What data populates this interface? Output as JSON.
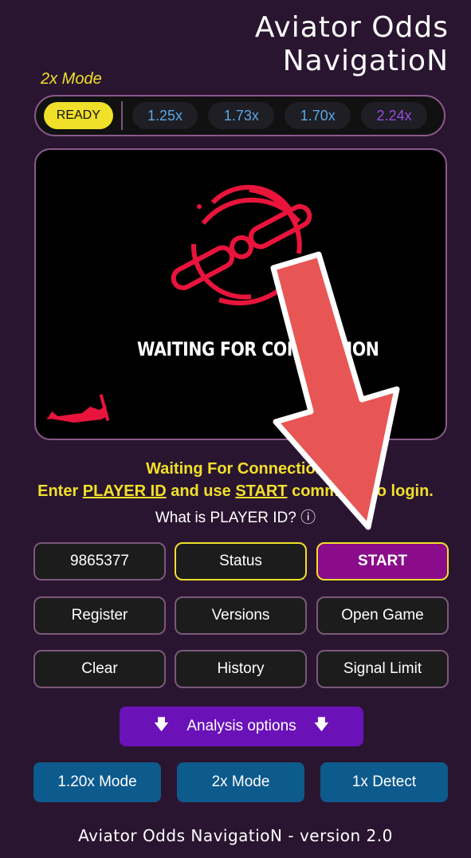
{
  "header": {
    "title_line1": "Aviator Odds",
    "title_line2": "NavigatioN"
  },
  "mode_label": "2x Mode",
  "odds_bar": {
    "ready_label": "READY",
    "odds": [
      {
        "value": "1.25x",
        "color": "#5ba6e8"
      },
      {
        "value": "1.73x",
        "color": "#5ba6e8"
      },
      {
        "value": "1.70x",
        "color": "#5ba6e8"
      },
      {
        "value": "2.24x",
        "color": "#9a4ae0"
      }
    ]
  },
  "game_screen": {
    "waiting_text": "WAITING FOR CONNECTION"
  },
  "status": {
    "line1": "Waiting For Connection",
    "line2_prefix": "Enter ",
    "line2_player_id": "PLAYER ID",
    "line2_mid": " and use ",
    "line2_start": "START",
    "line2_suffix": " command to login.",
    "what_is": "What is PLAYER ID? ⓘ"
  },
  "controls": {
    "player_id_value": "9865377",
    "status_label": "Status",
    "start_label": "START",
    "register_label": "Register",
    "versions_label": "Versions",
    "open_game_label": "Open Game",
    "clear_label": "Clear",
    "history_label": "History",
    "signal_limit_label": "Signal Limit",
    "analysis_label": "Analysis options",
    "analysis_arrow": "🡇"
  },
  "modes": {
    "mode1": "1.20x Mode",
    "mode2": "2x Mode",
    "mode3": "1x Detect"
  },
  "footer": "Aviator Odds NavigatioN -  version 2.0",
  "colors": {
    "accent_yellow": "#f0e02a",
    "start_purple": "#8a0c8a",
    "analysis_purple": "#6a12b8",
    "mode_blue": "#0d5a8c",
    "arrow_red": "#e85555"
  }
}
